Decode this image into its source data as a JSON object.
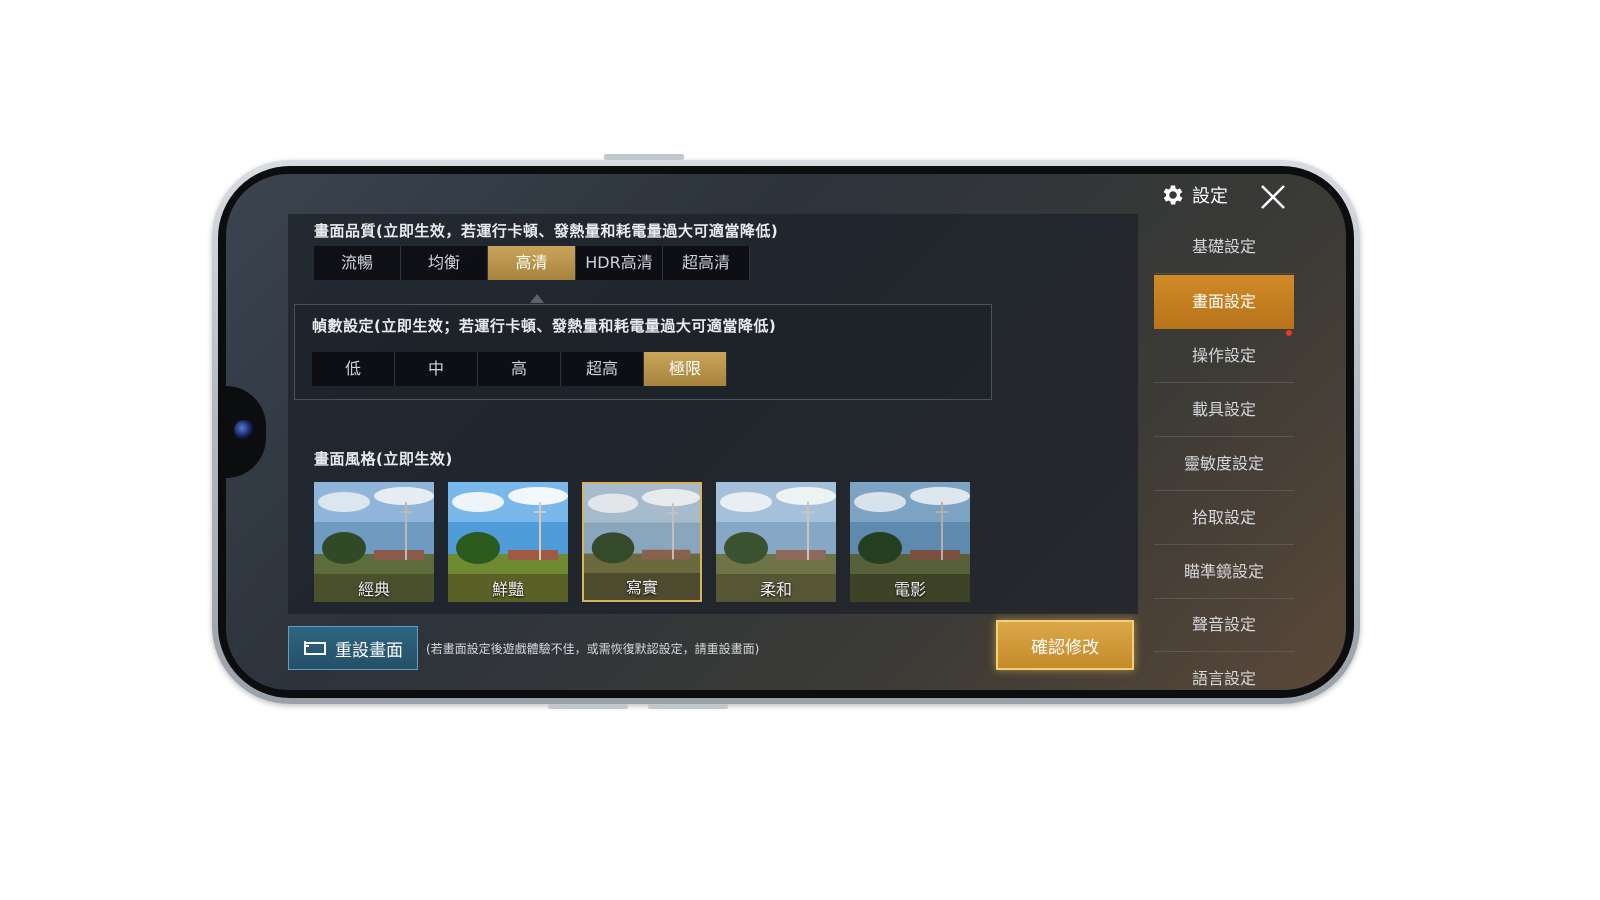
{
  "quality": {
    "label": "畫面品質(立即生效，若運行卡頓、發熱量和耗電量過大可適當降低)",
    "options": [
      "流暢",
      "均衡",
      "高清",
      "HDR高清",
      "超高清"
    ],
    "selected": "高清"
  },
  "fps": {
    "label": "幀數設定(立即生效；若運行卡頓、發熱量和耗電量過大可適當降低)",
    "options": [
      "低",
      "中",
      "高",
      "超高",
      "極限"
    ],
    "selected": "極限"
  },
  "style": {
    "label": "畫面風格(立即生效)",
    "options": [
      "經典",
      "鮮豔",
      "寫實",
      "柔和",
      "電影"
    ],
    "selected": "寫實"
  },
  "footer": {
    "reset_label": "重設畫面",
    "reset_note": "(若畫面設定後遊戲體驗不佳，或需恢復默認設定，請重設畫面)",
    "confirm_label": "確認修改"
  },
  "sidebar": {
    "title": "設定",
    "items": [
      "基礎設定",
      "畫面設定",
      "操作設定",
      "載具設定",
      "靈敏度設定",
      "拾取設定",
      "瞄準鏡設定",
      "聲音設定",
      "語言設定"
    ],
    "active": "畫面設定"
  },
  "colors": {
    "accent_orange": "#c8801f",
    "accent_gold": "#b8913f",
    "reset_blue": "#2a5a74"
  }
}
